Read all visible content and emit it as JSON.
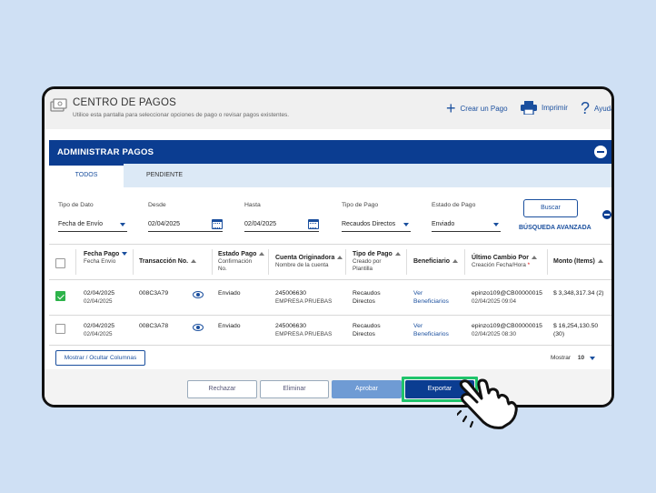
{
  "header": {
    "title": "CENTRO DE PAGOS",
    "subtitle": "Utilice esta pantalla para seleccionar opciones de pago o revisar pagos existentes.",
    "create_label": "Crear un Pago",
    "print_label": "Imprimir",
    "help_label": "Ayuda"
  },
  "section": {
    "title": "ADMINISTRAR PAGOS"
  },
  "tabs": [
    {
      "label": "TODOS"
    },
    {
      "label": "PENDIENTE"
    }
  ],
  "filters": {
    "tipo_dato": {
      "label": "Tipo de Dato",
      "value": "Fecha de Envío"
    },
    "desde": {
      "label": "Desde",
      "value": "02/04/2025"
    },
    "hasta": {
      "label": "Hasta",
      "value": "02/04/2025"
    },
    "tipo_pago": {
      "label": "Tipo de Pago",
      "value": "Recaudos Directos"
    },
    "estado_pago": {
      "label": "Estado de Pago",
      "value": "Enviado"
    },
    "search_label": "Buscar",
    "advanced_label": "BÚSQUEDA AVANZADA"
  },
  "table": {
    "columns": [
      {
        "title": "Fecha Pago",
        "sub": "Fecha Envío"
      },
      {
        "title": "Transacción No.",
        "sub": ""
      },
      {
        "title": "Estado Pago",
        "sub": "Confirmación",
        "sub2": "No."
      },
      {
        "title": "Cuenta Originadora",
        "sub": "Nombre de la cuenta"
      },
      {
        "title": "Tipo de Pago",
        "sub": "Creado por",
        "sub2": "Plantilla"
      },
      {
        "title": "Beneficiario",
        "sub": ""
      },
      {
        "title": "Último Cambio Por",
        "sub": "Creación Fecha/Hora"
      },
      {
        "title": "Monto (Items)",
        "sub": ""
      }
    ],
    "rows": [
      {
        "checked": true,
        "fecha": "02/04/2025",
        "envio": "02/04/2025",
        "trans": "008C3A79",
        "estado": "Enviado",
        "cuenta": "245006630",
        "nombre": "EMPRESA PRUEBAS",
        "tipo1": "Recaudos",
        "tipo2": "Directos",
        "ben1": "Ver",
        "ben2": "Beneficiarios",
        "user": "epinzo109@CB00000015",
        "fechahora": "02/04/2025 09:04",
        "monto": "$ 3,348,317.34 (2)",
        "monto2": ""
      },
      {
        "checked": false,
        "fecha": "02/04/2025",
        "envio": "02/04/2025",
        "trans": "008C3A78",
        "estado": "Enviado",
        "cuenta": "245006630",
        "nombre": "EMPRESA PRUEBAS",
        "tipo1": "Recaudos",
        "tipo2": "Directos",
        "ben1": "Ver",
        "ben2": "Beneficiarios",
        "user": "epinzo109@CB00000015",
        "fechahora": "02/04/2025 08:30",
        "monto": "$ 16,254,130.50",
        "monto2": "(30)"
      }
    ]
  },
  "columns_button": "Mostrar / Ocultar Columnas",
  "pager": {
    "label": "Mostrar",
    "value": "10"
  },
  "actions": {
    "reject": "Rechazar",
    "delete": "Eliminar",
    "approve": "Aprobar",
    "export": "Exportar"
  },
  "colors": {
    "primary": "#0b3d91",
    "link": "#1a4f9e",
    "highlight": "#1fc46b",
    "check": "#2db34a"
  }
}
